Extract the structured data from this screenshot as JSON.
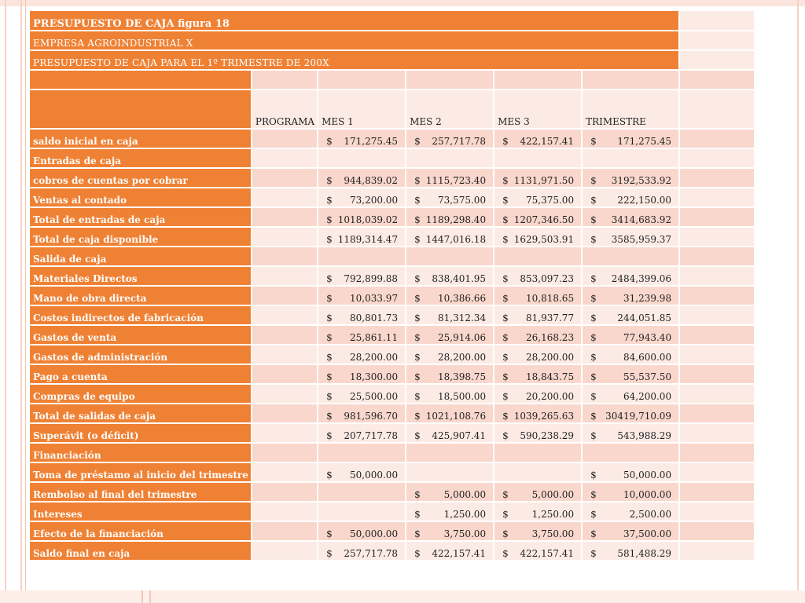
{
  "title": "PRESUPUESTO DE CAJA figura 18",
  "company": "EMPRESA AGROINDUSTRIAL X",
  "subtitle": "PRESUPUESTO DE CAJA PARA EL 1º TRIMESTRE DE 200X",
  "columns": [
    "PROGRAMA",
    "MES 1",
    "MES 2",
    "MES 3",
    "TRIMESTRE"
  ],
  "currency_symbol": "$",
  "rows": [
    {
      "label": "saldo inicial en caja",
      "values": [
        "",
        "171,275.45",
        "257,717.78",
        "422,157.41",
        "171,275.45"
      ]
    },
    {
      "label": "Entradas de caja",
      "values": [
        "",
        "",
        "",
        "",
        ""
      ]
    },
    {
      "label": "cobros de cuentas por cobrar",
      "values": [
        "",
        "944,839.02",
        "1115,723.40",
        "1131,971.50",
        "3192,533.92"
      ]
    },
    {
      "label": "Ventas al contado",
      "values": [
        "",
        "73,200.00",
        "73,575.00",
        "75,375.00",
        "222,150.00"
      ]
    },
    {
      "label": "Total de entradas de caja",
      "values": [
        "",
        "1018,039.02",
        "1189,298.40",
        "1207,346.50",
        "3414,683.92"
      ]
    },
    {
      "label": "Total de caja disponible",
      "values": [
        "",
        "1189,314.47",
        "1447,016.18",
        "1629,503.91",
        "3585,959.37"
      ]
    },
    {
      "label": "Salida de caja",
      "values": [
        "",
        "",
        "",
        "",
        ""
      ]
    },
    {
      "label": "Materiales Directos",
      "values": [
        "",
        "792,899.88",
        "838,401.95",
        "853,097.23",
        "2484,399.06"
      ]
    },
    {
      "label": "Mano de obra directa",
      "values": [
        "",
        "10,033.97",
        "10,386.66",
        "10,818.65",
        "31,239.98"
      ]
    },
    {
      "label": "Costos indirectos de fabricación",
      "values": [
        "",
        "80,801.73",
        "81,312.34",
        "81,937.77",
        "244,051.85"
      ]
    },
    {
      "label": "Gastos de venta",
      "values": [
        "",
        "25,861.11",
        "25,914.06",
        "26,168.23",
        "77,943.40"
      ]
    },
    {
      "label": "Gastos de administración",
      "values": [
        "",
        "28,200.00",
        "28,200.00",
        "28,200.00",
        "84,600.00"
      ]
    },
    {
      "label": "Pago a cuenta",
      "values": [
        "",
        "18,300.00",
        "18,398.75",
        "18,843.75",
        "55,537.50"
      ]
    },
    {
      "label": "Compras de equipo",
      "values": [
        "",
        "25,500.00",
        "18,500.00",
        "20,200.00",
        "64,200.00"
      ]
    },
    {
      "label": "Total de salidas de caja",
      "values": [
        "",
        "981,596.70",
        "1021,108.76",
        "1039,265.63",
        "30419,710.09"
      ]
    },
    {
      "label": "Superávit (o déficit)",
      "values": [
        "",
        "207,717.78",
        "425,907.41",
        "590,238.29",
        "543,988.29"
      ]
    },
    {
      "label": "Financiación",
      "values": [
        "",
        "",
        "",
        "",
        ""
      ]
    },
    {
      "label": "Toma de préstamo al inicio del trimestre",
      "values": [
        "",
        "50,000.00",
        "",
        "",
        "50,000.00"
      ]
    },
    {
      "label": "Rembolso al final del trimestre",
      "values": [
        "",
        "",
        "5,000.00",
        "5,000.00",
        "10,000.00"
      ]
    },
    {
      "label": "Intereses",
      "values": [
        "",
        "",
        "1,250.00",
        "1,250.00",
        "2,500.00"
      ]
    },
    {
      "label": "Efecto de la financiación",
      "values": [
        "",
        "50,000.00",
        "3,750.00",
        "3,750.00",
        "37,500.00"
      ]
    },
    {
      "label": "Saldo final en caja",
      "values": [
        "",
        "257,717.78",
        "422,157.41",
        "422,157.41",
        "581,488.29"
      ]
    }
  ],
  "colors": {
    "accent_orange": "#ef8134",
    "row_pink": "#f9d7cc",
    "row_light": "#fcebe5"
  }
}
